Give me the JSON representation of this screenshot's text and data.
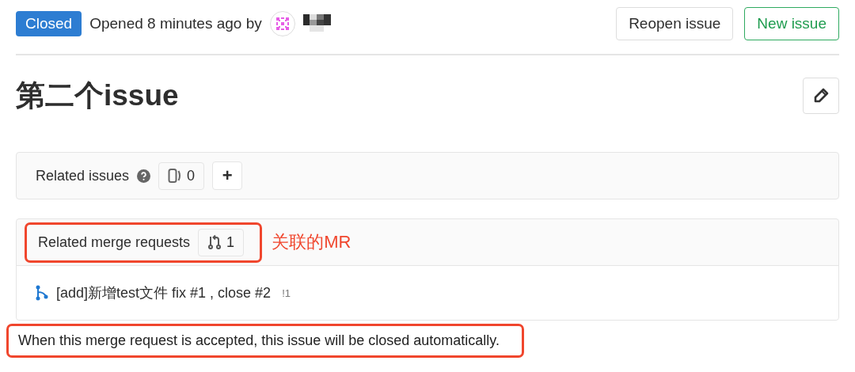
{
  "header": {
    "status": {
      "label": "Closed",
      "kind": "closed"
    },
    "meta": "Opened 8 minutes ago by",
    "buttons": [
      {
        "label": "Reopen issue",
        "kind": "default"
      },
      {
        "label": "New issue",
        "kind": "success"
      }
    ]
  },
  "title": "第二个issue",
  "related_issues": {
    "title": "Related issues",
    "count": "0",
    "add_label": "+"
  },
  "related_mrs": {
    "title": "Related merge requests",
    "count": "1",
    "highlighted": true,
    "annotation": "关联的MR",
    "items": [
      {
        "title": "[add]新增test文件 fix #1 , close #2",
        "ref": "!1"
      }
    ]
  },
  "note": {
    "text": "When this merge request is accepted, this issue will be closed automatically.",
    "highlighted": true
  }
}
